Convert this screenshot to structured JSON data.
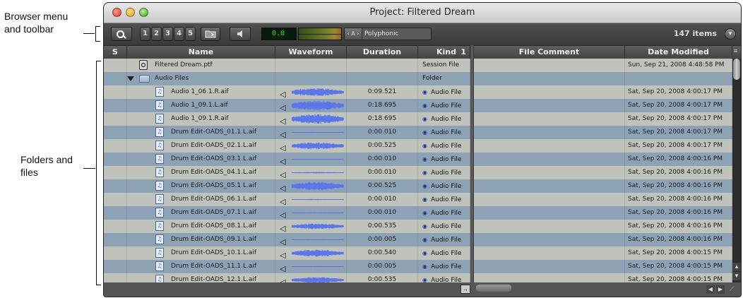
{
  "annotations": {
    "toolbar_callout": [
      "Browser menu",
      "and toolbar"
    ],
    "files_callout": [
      "Folders and",
      "files"
    ]
  },
  "window": {
    "title": "Project: Filtered Dream"
  },
  "toolbar": {
    "search_icon": "magnifier-icon",
    "views": [
      "1",
      "2",
      "3",
      "4",
      "5"
    ],
    "folder_button_icon": "folder-icon",
    "audition_icon": "speaker-icon",
    "level_value": "0.0",
    "mode_arrows": "‹ A ›",
    "mode_label": "Polyphonic",
    "item_count": "147 items"
  },
  "columns": {
    "s": "S",
    "name": "Name",
    "waveform": "Waveform",
    "duration": "Duration",
    "kind": "Kind",
    "kind_sort": "1",
    "comment": "File Comment",
    "date": "Date Modified"
  },
  "colors": {
    "row_light": "#c0c2bc",
    "row_blue": "#8ea2b6",
    "waveform": "#5b76e8"
  },
  "rows": [
    {
      "type": "session",
      "indent": 1,
      "name": "Filtered Dream.ptf",
      "duration": "",
      "kind": "Session File",
      "date": "Sun, Sep 21, 2008 4:48:58 PM",
      "wave": 0
    },
    {
      "type": "folder",
      "indent": 1,
      "name": "Audio Files",
      "duration": "",
      "kind": "Folder",
      "date": "",
      "wave": 0
    },
    {
      "type": "audio",
      "indent": 2,
      "name": "Audio 1_06.1.R.aif",
      "duration": "0:09.521",
      "kind": "Audio File",
      "date": "Sat, Sep 20, 2008 4:00:17 PM",
      "wave": 0.8
    },
    {
      "type": "audio",
      "indent": 2,
      "name": "Audio 1_09.1.L.aif",
      "duration": "0:18.695",
      "kind": "Audio File",
      "date": "Sat, Sep 20, 2008 4:00:17 PM",
      "wave": 1
    },
    {
      "type": "audio",
      "indent": 2,
      "name": "Audio 1_09.1.R.aif",
      "duration": "0:18.695",
      "kind": "Audio File",
      "date": "Sat, Sep 20, 2008 4:00:17 PM",
      "wave": 1
    },
    {
      "type": "audio",
      "indent": 2,
      "name": "Drum Edit-OADS_01.1.L.aif",
      "duration": "0:00.010",
      "kind": "Audio File",
      "date": "Sat, Sep 20, 2008 4:00:17 PM",
      "wave": 0.1
    },
    {
      "type": "audio",
      "indent": 2,
      "name": "Drum Edit-OADS_02.1.L.aif",
      "duration": "0:00.525",
      "kind": "Audio File",
      "date": "Sat, Sep 20, 2008 4:00:17 PM",
      "wave": 0.7
    },
    {
      "type": "audio",
      "indent": 2,
      "name": "Drum Edit-OADS_03.1.L.aif",
      "duration": "0:00.010",
      "kind": "Audio File",
      "date": "Sat, Sep 20, 2008 4:00:16 PM",
      "wave": 0.1
    },
    {
      "type": "audio",
      "indent": 2,
      "name": "Drum Edit-OADS_04.1.L.aif",
      "duration": "0:00.010",
      "kind": "Audio File",
      "date": "Sat, Sep 20, 2008 4:00:16 PM",
      "wave": 0.15
    },
    {
      "type": "audio",
      "indent": 2,
      "name": "Drum Edit-OADS_05.1.L.aif",
      "duration": "0:00.525",
      "kind": "Audio File",
      "date": "Sat, Sep 20, 2008 4:00:16 PM",
      "wave": 0.9
    },
    {
      "type": "audio",
      "indent": 2,
      "name": "Drum Edit-OADS_06.1.L.aif",
      "duration": "0:00.010",
      "kind": "Audio File",
      "date": "Sat, Sep 20, 2008 4:00:16 PM",
      "wave": 0.1
    },
    {
      "type": "audio",
      "indent": 2,
      "name": "Drum Edit-OADS_07.1.L.aif",
      "duration": "0:00.010",
      "kind": "Audio File",
      "date": "Sat, Sep 20, 2008 4:00:16 PM",
      "wave": 0.1
    },
    {
      "type": "audio",
      "indent": 2,
      "name": "Drum Edit-OADS_08.1.L.aif",
      "duration": "0:00.535",
      "kind": "Audio File",
      "date": "Sat, Sep 20, 2008 4:00:16 PM",
      "wave": 0.6
    },
    {
      "type": "audio",
      "indent": 2,
      "name": "Drum Edit-OADS_09.1.L.aif",
      "duration": "0:00.005",
      "kind": "Audio File",
      "date": "Sat, Sep 20, 2008 4:00:16 PM",
      "wave": 0.1
    },
    {
      "type": "audio",
      "indent": 2,
      "name": "Drum Edit-OADS_10.1.L.aif",
      "duration": "0:00.540",
      "kind": "Audio File",
      "date": "Sat, Sep 20, 2008 4:00:15 PM",
      "wave": 0.7
    },
    {
      "type": "audio",
      "indent": 2,
      "name": "Drum Edit-OADS_11.1.L.aif",
      "duration": "0:00.005",
      "kind": "Audio File",
      "date": "Sat, Sep 20, 2008 4:00:15 PM",
      "wave": 0.1
    },
    {
      "type": "audio",
      "indent": 2,
      "name": "Drum Edit-OADS_12.1.L.aif",
      "duration": "0:00.535",
      "kind": "Audio File",
      "date": "Sat, Sep 20, 2008 4:00:15 PM",
      "wave": 0.6
    }
  ]
}
